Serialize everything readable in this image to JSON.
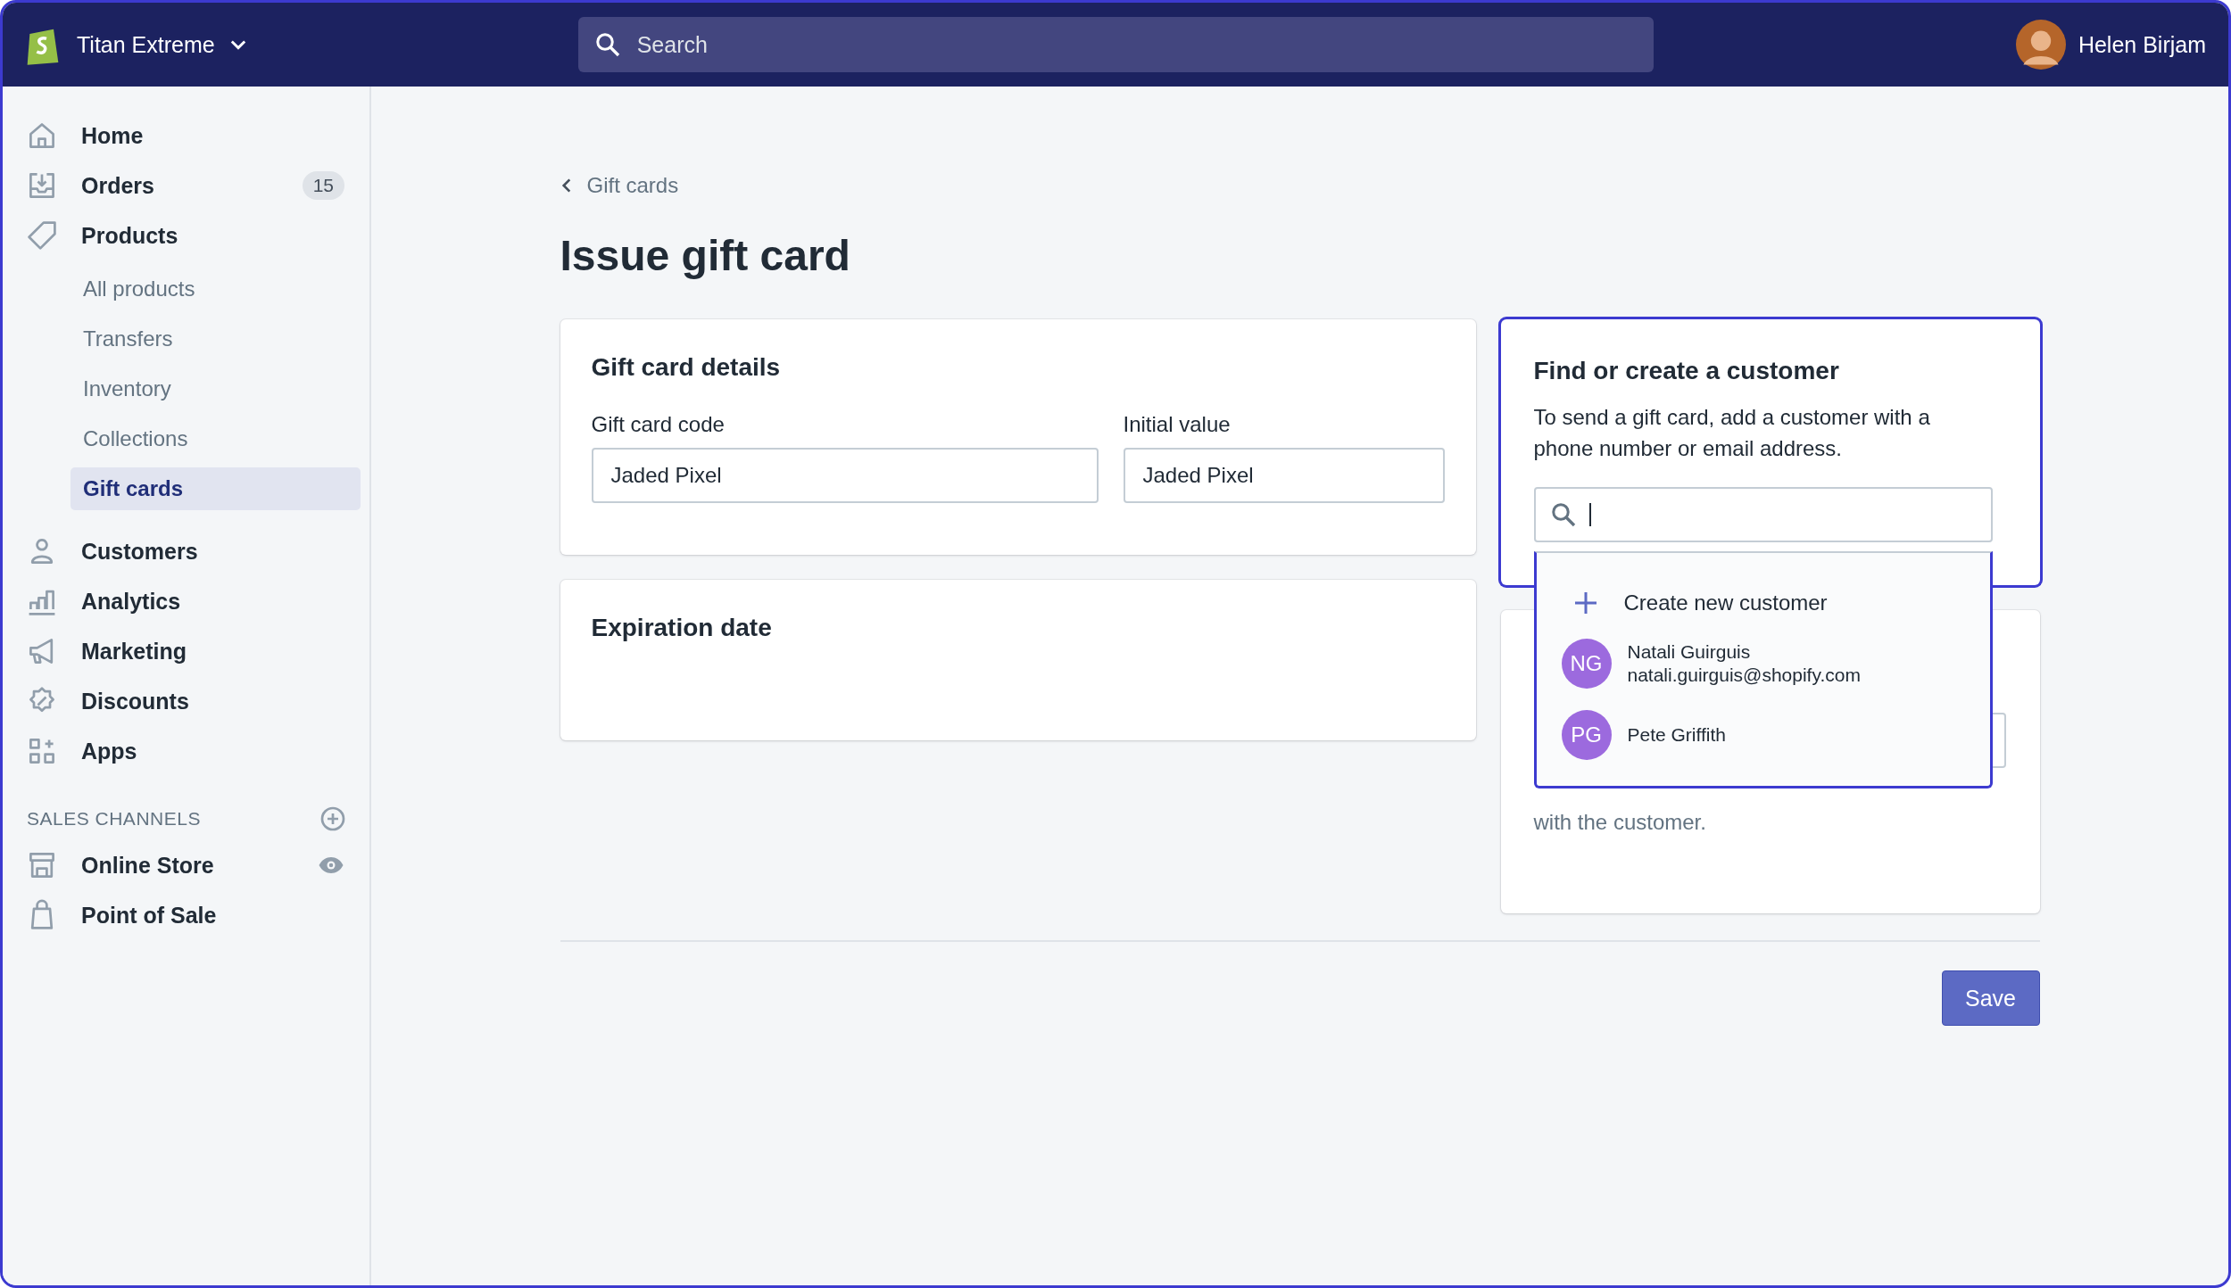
{
  "top_bar": {
    "store_name": "Titan Extreme",
    "search": {
      "placeholder": "Search"
    },
    "user_name": "Helen Birjam"
  },
  "sidebar": {
    "items": [
      {
        "label": "Home",
        "selected": false
      },
      {
        "label": "Orders",
        "selected": false,
        "badge": "15"
      },
      {
        "label": "Products",
        "selected": false,
        "children": [
          {
            "label": "All products",
            "selected": false
          },
          {
            "label": "Transfers",
            "selected": false
          },
          {
            "label": "Inventory",
            "selected": false
          },
          {
            "label": "Collections",
            "selected": false
          },
          {
            "label": "Gift cards",
            "selected": true
          }
        ]
      },
      {
        "label": "Customers",
        "selected": false
      },
      {
        "label": "Analytics",
        "selected": false
      },
      {
        "label": "Marketing",
        "selected": false
      },
      {
        "label": "Discounts",
        "selected": false
      },
      {
        "label": "Apps",
        "selected": false
      }
    ],
    "sales_channels": {
      "heading": "SALES CHANNELS",
      "items": [
        {
          "label": "Online Store",
          "selected": false
        },
        {
          "label": "Point of Sale",
          "selected": false
        }
      ]
    }
  },
  "breadcrumb": "Gift cards",
  "title": "Issue gift card",
  "gift_card_details": {
    "heading": "Gift card details",
    "fields": [
      {
        "label": "Gift card code",
        "value": "Jaded Pixel"
      },
      {
        "label": "Initial value",
        "value": "Jaded Pixel"
      }
    ]
  },
  "expiration_date": {
    "heading": "Expiration date"
  },
  "customer": {
    "heading": "Find or create a customer",
    "description": "To send a gift card, add a customer with a phone number or email address.",
    "search": {
      "focused": true
    },
    "dropdown": [
      {
        "kind": "action",
        "label": "Create new customer"
      },
      {
        "kind": "customer",
        "initials": "NG",
        "name": "Natali Guirguis",
        "email": "natali.guirguis@shopify.com"
      },
      {
        "kind": "customer",
        "initials": "PG",
        "name": "Pete Griffith"
      }
    ]
  },
  "notes": {
    "help": "with the customer."
  },
  "save_button": "Save"
}
